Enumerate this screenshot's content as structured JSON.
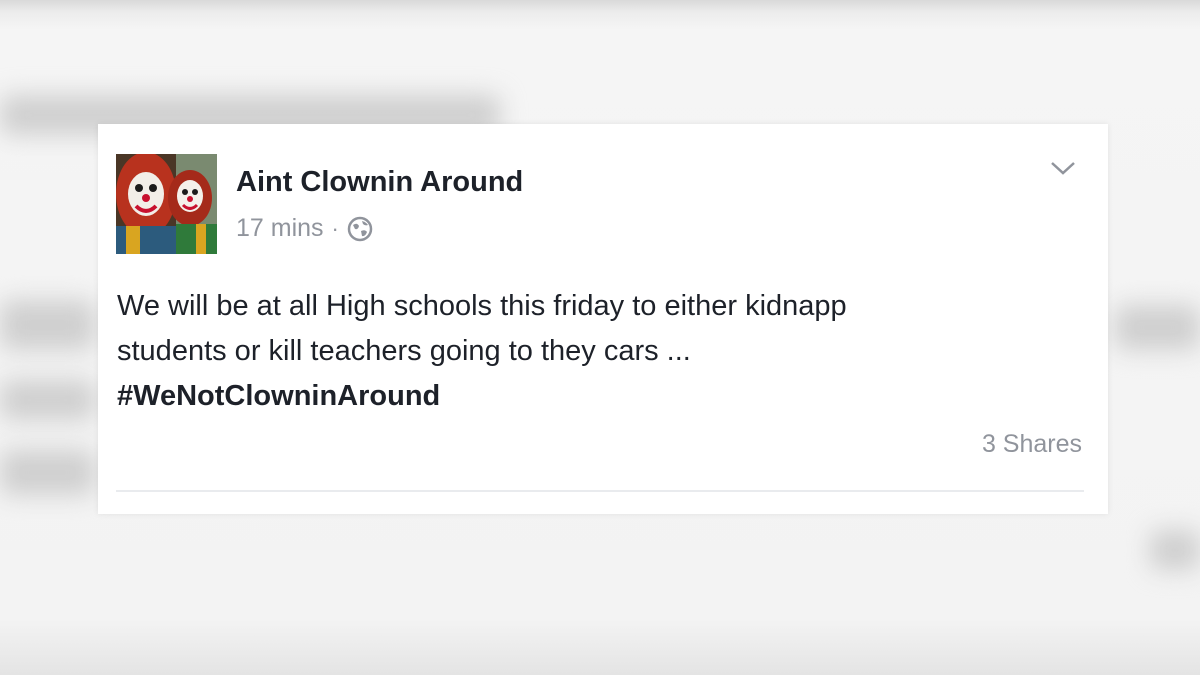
{
  "post": {
    "author_name": "Aint Clownin Around",
    "timestamp": "17 mins",
    "separator": "·",
    "privacy_icon": "globe-icon",
    "options_icon": "chevron-down-icon",
    "text_line_1": "We will be at all High schools this friday to either kidnapp",
    "text_line_2": "students or kill teachers going to they cars ...",
    "hashtag": "#WeNotClowninAround",
    "shares": "3 Shares"
  },
  "colors": {
    "text_primary": "#1d2129",
    "text_secondary": "#90949c",
    "card_background": "#ffffff",
    "page_background": "#f2f2f2"
  }
}
